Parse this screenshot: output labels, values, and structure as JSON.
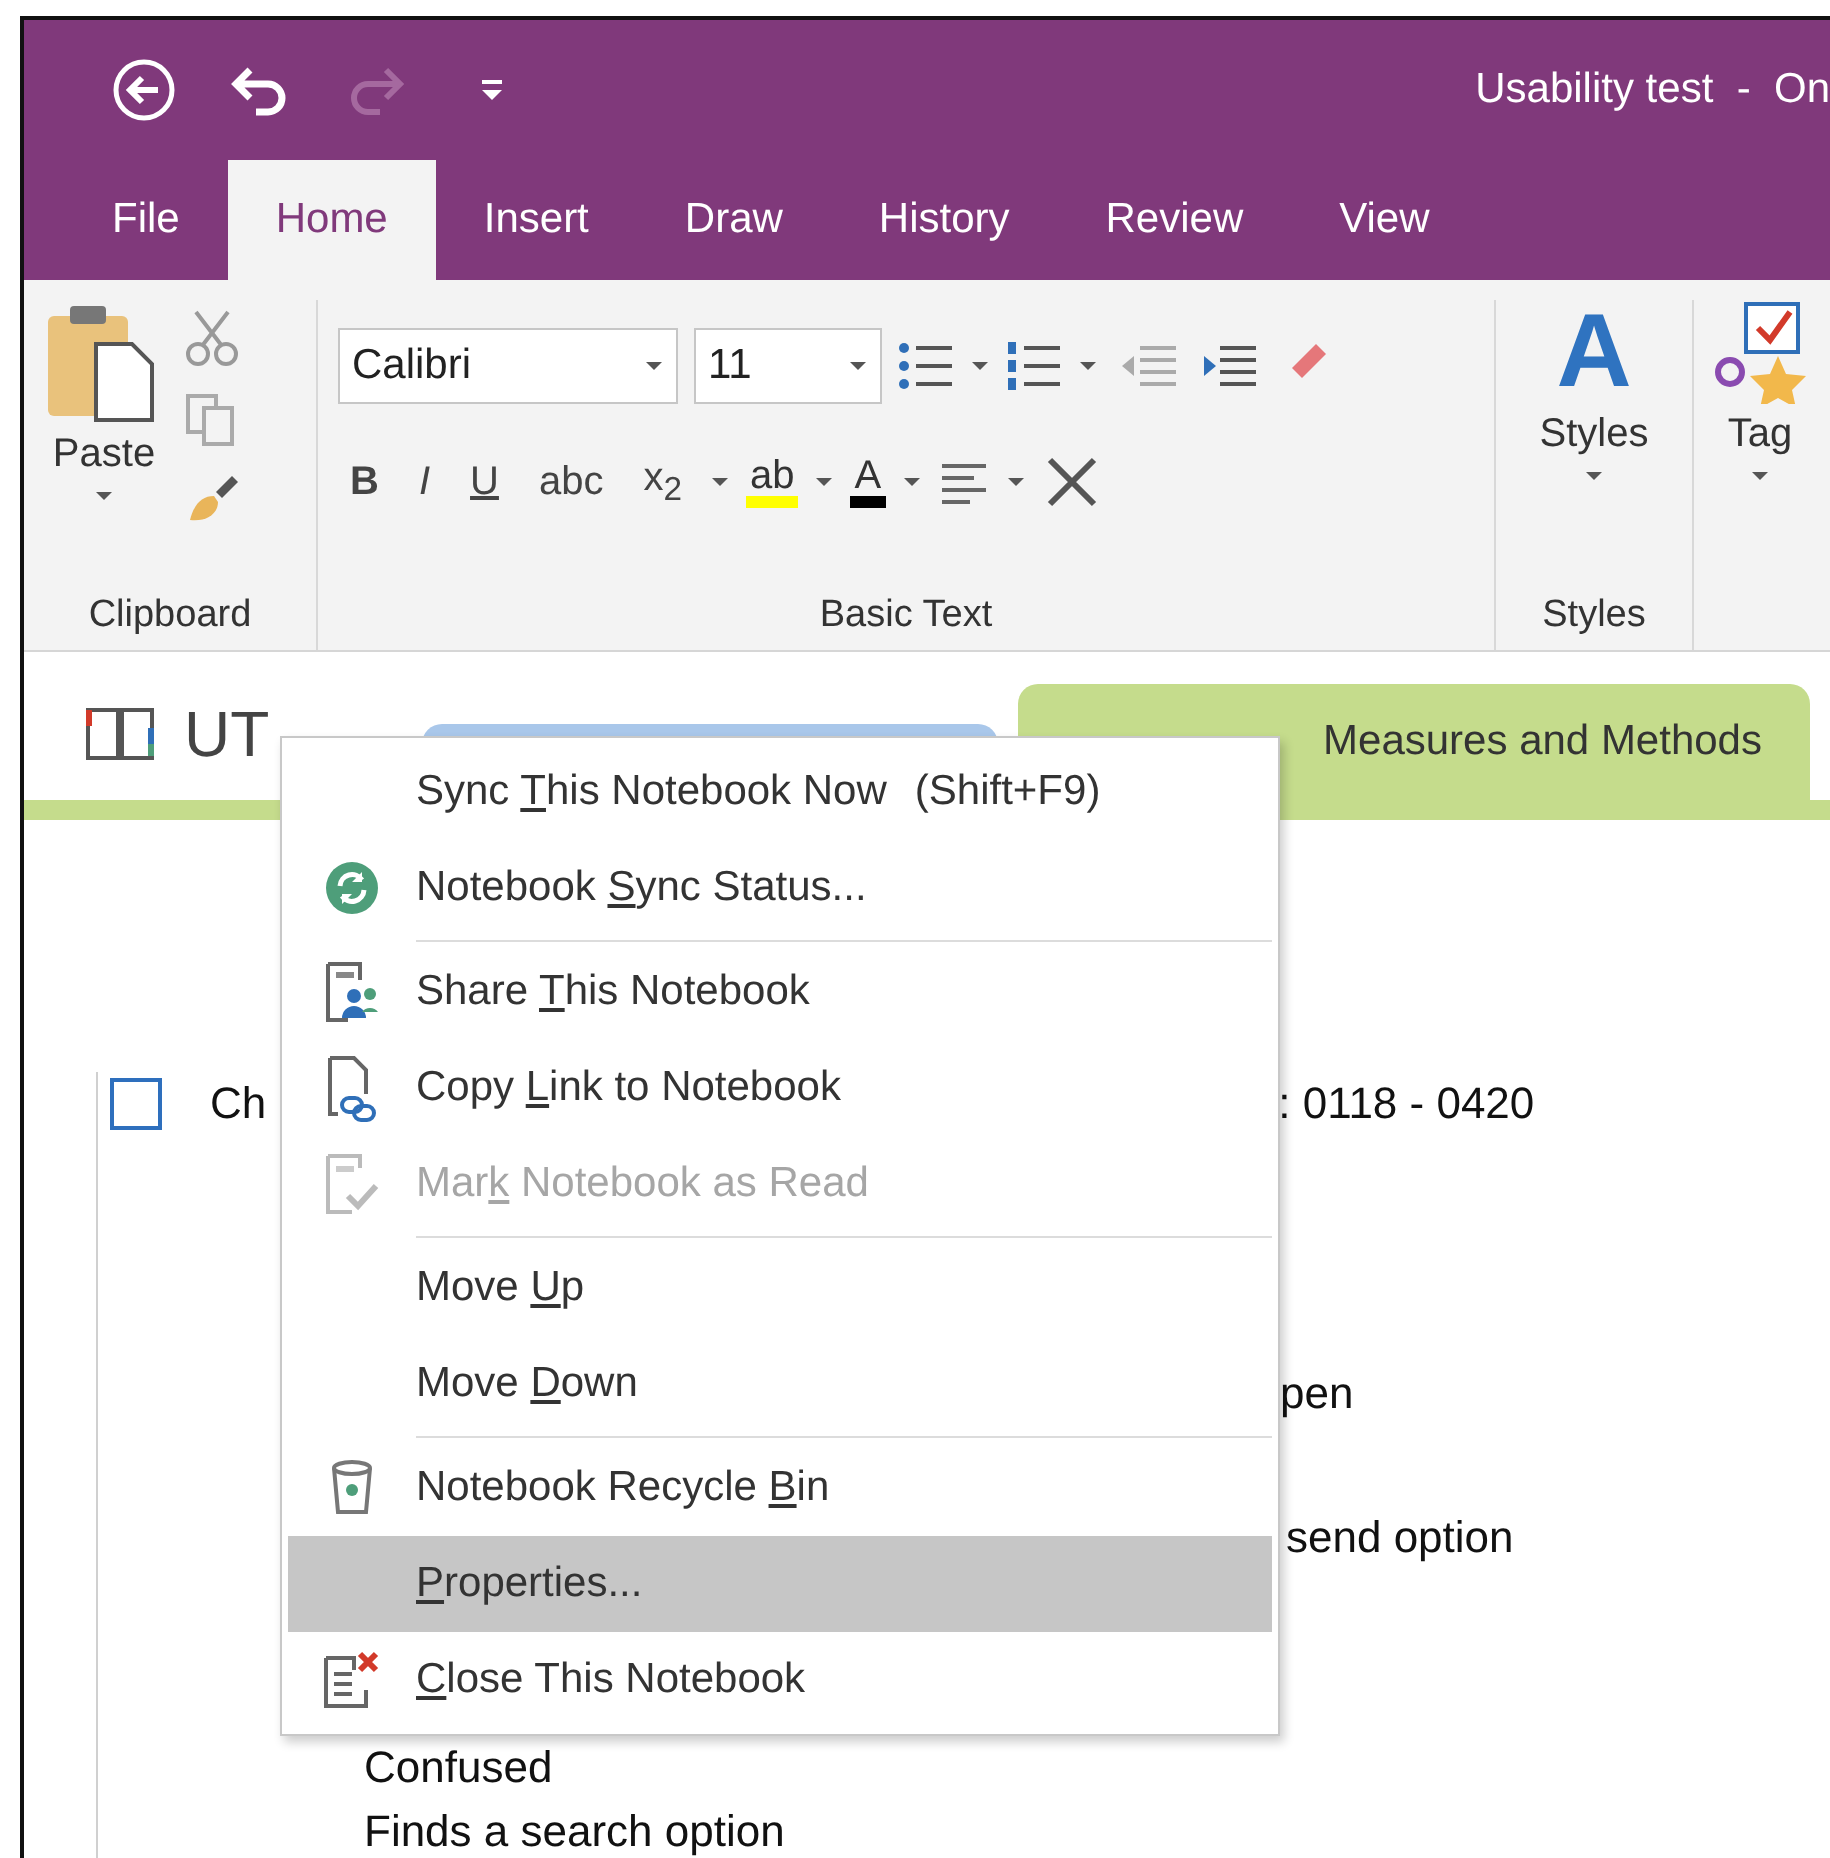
{
  "title_bar": {
    "quick_access": [
      {
        "kind": "back",
        "disabled": false
      },
      {
        "kind": "undo",
        "disabled": false
      },
      {
        "kind": "redo",
        "disabled": true
      },
      {
        "kind": "customize",
        "disabled": false
      }
    ],
    "title": "Usability test  -  On"
  },
  "tabs": [
    {
      "label": "File",
      "selected": false
    },
    {
      "label": "Home",
      "selected": true
    },
    {
      "label": "Insert",
      "selected": false
    },
    {
      "label": "Draw",
      "selected": false
    },
    {
      "label": "History",
      "selected": false
    },
    {
      "label": "Review",
      "selected": false
    },
    {
      "label": "View",
      "selected": false
    }
  ],
  "ribbon": {
    "clipboard": {
      "paste": "Paste",
      "label": "Clipboard"
    },
    "basic_text": {
      "font": "Calibri",
      "size": "11",
      "format_buttons": [
        "B",
        "I",
        "U",
        "abc",
        "x$_{2}$"
      ],
      "highlight": "ab",
      "font_color": "A",
      "label": "Basic Text"
    },
    "styles": {
      "glyph": "A",
      "button": "Styles",
      "label": "Styles"
    },
    "tags": {
      "button": "Tag"
    }
  },
  "notebook": {
    "name": "UT",
    "section_tabs": [
      {
        "color": "#a9c7ea",
        "selected": false
      },
      {
        "label": "Measures and Methods",
        "color": "#c5dc8c",
        "selected": true
      }
    ]
  },
  "page": {
    "todo": {
      "checked": false,
      "text": "Ch"
    },
    "lines": [
      ": 0118 - 0420",
      "pen",
      "send option",
      "Confused",
      "Finds a search option"
    ]
  },
  "context_menu": {
    "items": [
      {
        "kind": "command",
        "before": "Sync ",
        "key": "T",
        "after": "his Notebook Now",
        "shortcut": "(Shift+F9)",
        "disabled": false,
        "selected": false
      },
      {
        "kind": "command",
        "before": "Notebook ",
        "key": "S",
        "after": "ync Status...",
        "disabled": false,
        "selected": false
      },
      {
        "kind": "separator"
      },
      {
        "kind": "command",
        "before": "Share ",
        "key": "T",
        "after": "his Notebook",
        "disabled": false,
        "selected": false
      },
      {
        "kind": "command",
        "before": "Copy ",
        "key": "L",
        "after": "ink to Notebook",
        "disabled": false,
        "selected": false
      },
      {
        "kind": "command",
        "before": "Mar",
        "key": "k",
        "after": " Notebook as Read",
        "disabled": true,
        "selected": false
      },
      {
        "kind": "separator"
      },
      {
        "kind": "command",
        "before": "Move ",
        "key": "U",
        "after": "p",
        "disabled": false,
        "selected": false
      },
      {
        "kind": "command",
        "before": "Move ",
        "key": "D",
        "after": "own",
        "disabled": false,
        "selected": false
      },
      {
        "kind": "separator"
      },
      {
        "kind": "command",
        "before": "Notebook Recycle ",
        "key": "B",
        "after": "in",
        "disabled": false,
        "selected": false
      },
      {
        "kind": "command",
        "key": "P",
        "after": "roperties...",
        "disabled": false,
        "selected": true
      },
      {
        "kind": "command",
        "key": "C",
        "after": "lose This Notebook",
        "disabled": false,
        "selected": false
      }
    ]
  }
}
